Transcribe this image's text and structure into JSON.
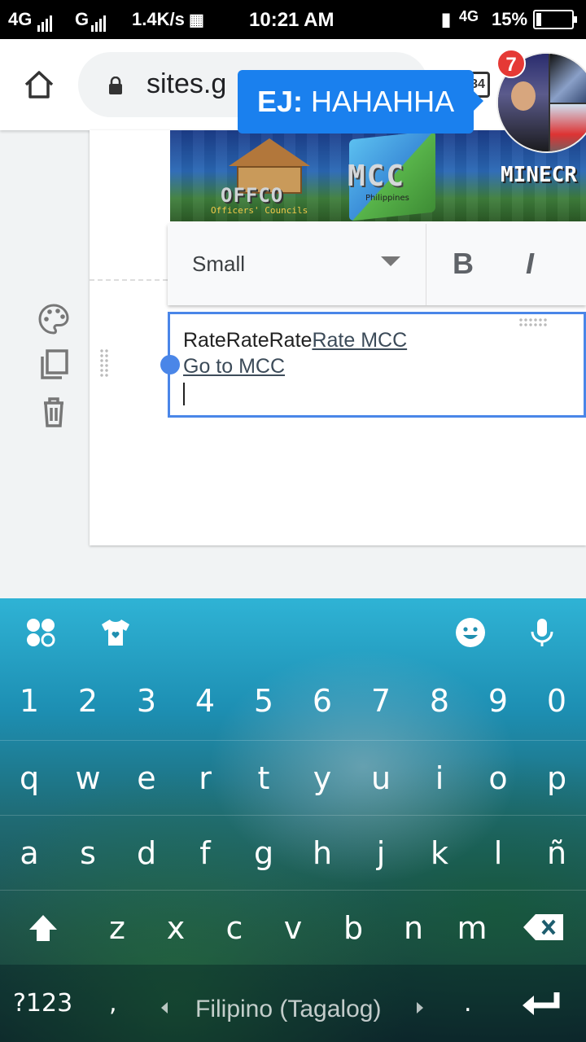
{
  "status_bar": {
    "network_1": "4G",
    "network_2": "G",
    "speed": "1.4K/s",
    "time": "10:21 AM",
    "network_3": "4G",
    "battery_percent": "15%",
    "battery_level": 0.15
  },
  "browser": {
    "url": "sites.g",
    "tab_count": "34"
  },
  "chat_head": {
    "sender": "EJ:",
    "message": "HAHAHHA",
    "unread_count": "7"
  },
  "banner": {
    "left_logo": "OFFCO",
    "left_logo_sub": "Officers' Councils",
    "center_logo": "MCC",
    "center_logo_sub": "Philippines",
    "right_text": "MINECR"
  },
  "format_toolbar": {
    "font_size": "Small",
    "bold_label": "B",
    "italic_label": "I"
  },
  "text_box": {
    "plain_text": "RateRateRate",
    "link_1": "Rate MCC",
    "link_2": "Go to MCC"
  },
  "keyboard": {
    "number_row": [
      "1",
      "2",
      "3",
      "4",
      "5",
      "6",
      "7",
      "8",
      "9",
      "0"
    ],
    "row_1": [
      "q",
      "w",
      "e",
      "r",
      "t",
      "y",
      "u",
      "i",
      "o",
      "p"
    ],
    "row_2": [
      "a",
      "s",
      "d",
      "f",
      "g",
      "h",
      "j",
      "k",
      "l",
      "ñ"
    ],
    "row_3": [
      "z",
      "x",
      "c",
      "v",
      "b",
      "n",
      "m"
    ],
    "symbols_key": "?123",
    "comma_key": ",",
    "language": "Filipino (Tagalog)",
    "period_key": "."
  }
}
